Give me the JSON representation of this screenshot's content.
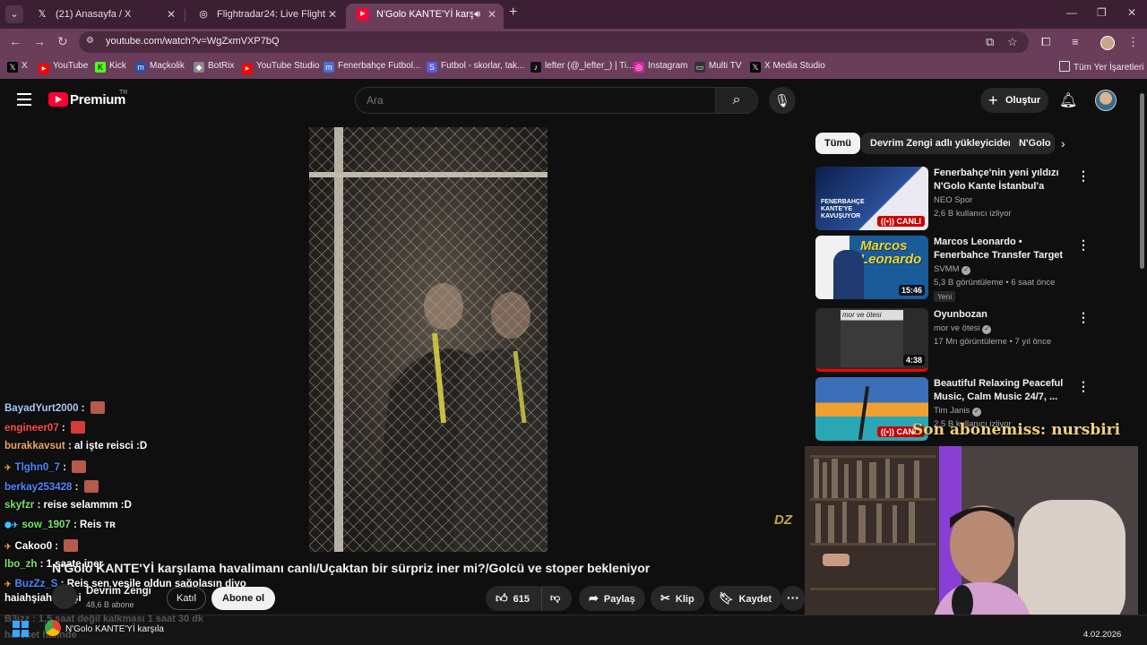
{
  "browser": {
    "tabs": [
      {
        "title": "(21) Anasayfa / X",
        "icon": "x-logo-icon"
      },
      {
        "title": "Flightradar24: Live Flight Tracker",
        "icon": "flightradar-icon"
      },
      {
        "title": "N'Golo KANTE'Yİ karşılama",
        "icon": "youtube-icon",
        "active": true
      }
    ],
    "url": "youtube.com/watch?v=WgZxmVXP7bQ",
    "bookmarks": [
      {
        "label": "X",
        "color": "#000000",
        "glyph": "𝕏"
      },
      {
        "label": "YouTube",
        "color": "#ff0000",
        "glyph": "▶"
      },
      {
        "label": "Kick",
        "color": "#53fc18",
        "glyph": "K"
      },
      {
        "label": "Maçkolik",
        "color": "#2a4fa8",
        "glyph": "m"
      },
      {
        "label": "BotRix",
        "color": "#888888",
        "glyph": "◆"
      },
      {
        "label": "YouTube Studio",
        "color": "#ff0000",
        "glyph": "▶"
      },
      {
        "label": "Fenerbahçe Futbol...",
        "color": "#4a6fd8",
        "glyph": "m"
      },
      {
        "label": "Futbol - skorlar, tak...",
        "color": "#5a5ae0",
        "glyph": "S"
      },
      {
        "label": "lefter (@_lefter_) | Ti...",
        "color": "#111111",
        "glyph": "♪"
      },
      {
        "label": "Instagram",
        "color": "#d6249f",
        "glyph": "◎"
      },
      {
        "label": "Multi TV",
        "color": "#333333",
        "glyph": "▭"
      },
      {
        "label": "X Media Studio",
        "color": "#000000",
        "glyph": "𝕏"
      }
    ],
    "all_bookmarks": "Tüm Yer İşaretleri"
  },
  "header": {
    "brand": "Premium",
    "region": "TR",
    "search_placeholder": "Ara",
    "create_label": "Oluştur"
  },
  "chips": [
    {
      "label": "Tümü",
      "active": true
    },
    {
      "label": "Devrim Zengi adlı yükleyiciden"
    },
    {
      "label": "N'Golo"
    }
  ],
  "recommendations": [
    {
      "title": "Fenerbahçe'nin yeni yıldızı N'Golo Kante İstanbul'a geliyor...",
      "channel": "NEO Spor",
      "meta": "2,6 B kullanıcı izliyor",
      "badge": "CANLI",
      "thumb": "#1b3a7a",
      "thumb_text": "FENERBAHÇE KANTE'YE KAVUŞUYOR"
    },
    {
      "title": "Marcos Leonardo • Fenerbahce Transfer Target 2026 😀 🔵 BR ...",
      "channel": "SVMM",
      "meta": "5,3 B görüntüleme • 6 saat önce",
      "duration": "15:46",
      "new": "Yeni",
      "thumb": "#1a5b9a",
      "thumb_text": "Marcos Leonardo"
    },
    {
      "title": "Oyunbozan",
      "channel": "mor ve ötesi",
      "meta": "17 Mn görüntüleme • 7 yıl önce",
      "duration": "4:38",
      "thumb": "#2b2b2b",
      "thumb_text": "mor ve ötesi"
    },
    {
      "title": "Beautiful Relaxing Peaceful Music, Calm Music 24/7, ...",
      "channel": "Tim Janis",
      "meta": "2,5 B kullanıcı izliyor",
      "badge": "CANLI",
      "thumb": "#d98a2b",
      "thumb_text": ""
    }
  ],
  "chat": [
    {
      "user": "BayadYurt2000",
      "color": "#a9c9ff",
      "text": "",
      "emote": true
    },
    {
      "user": "engineer07",
      "color": "#ff4d4d",
      "text": "",
      "emote": true
    },
    {
      "user": "burakkavsut",
      "color": "#f0a56a",
      "text": "al işte reisci :D"
    },
    {
      "user": "Tlghn0_7",
      "color": "#4d88ff",
      "text": "",
      "emote": true,
      "badge": true
    },
    {
      "user": "berkay253428",
      "color": "#4d88ff",
      "text": "",
      "emote": true
    },
    {
      "user": "skyfzr",
      "color": "#7be26b",
      "text": "reise selammm :D"
    },
    {
      "user": "sow_1907",
      "color": "#7be26b",
      "text": "Reis ᴛʀ",
      "badge": true
    },
    {
      "user": "Cakoo0",
      "color": "#ffffff",
      "text": "",
      "emote": true,
      "badge": true
    },
    {
      "user": "lbo_zh",
      "color": "#7be26b",
      "text": "1 saate iner"
    },
    {
      "user": "BuzZz_S",
      "color": "#4d88ff",
      "text": "Reis sen vesile oldun sağolasın diyo",
      "badge": true
    },
    {
      "user": "",
      "color": "#ffffff",
      "text": "haiahşiahşiahşi"
    }
  ],
  "video": {
    "title": "N'Golo KANTE'Yİ karşılama havalimanı canlı/Uçaktan bir sürpriz iner mi?/Golcü ve stoper bekleniyor",
    "channel": "Devrim Zengi",
    "subs": "48,6 B abone",
    "join_label": "Katıl",
    "subscribe_label": "Abone ol",
    "likes": "615",
    "share_label": "Paylaş",
    "clip_label": "Klip",
    "save_label": "Kaydet",
    "watermark": "DZ"
  },
  "overlay": {
    "last_sub": "Son abonemiss: nursbiri"
  },
  "taskbar": {
    "window_label": "N'Golo KANTE'Yİ karşıla",
    "date": "4.02.2026",
    "ghost_line1": "B3izz : 1,5 saat değil kalkması 1 saat 30 dk",
    "ghost_line2": "hareket halinde"
  }
}
